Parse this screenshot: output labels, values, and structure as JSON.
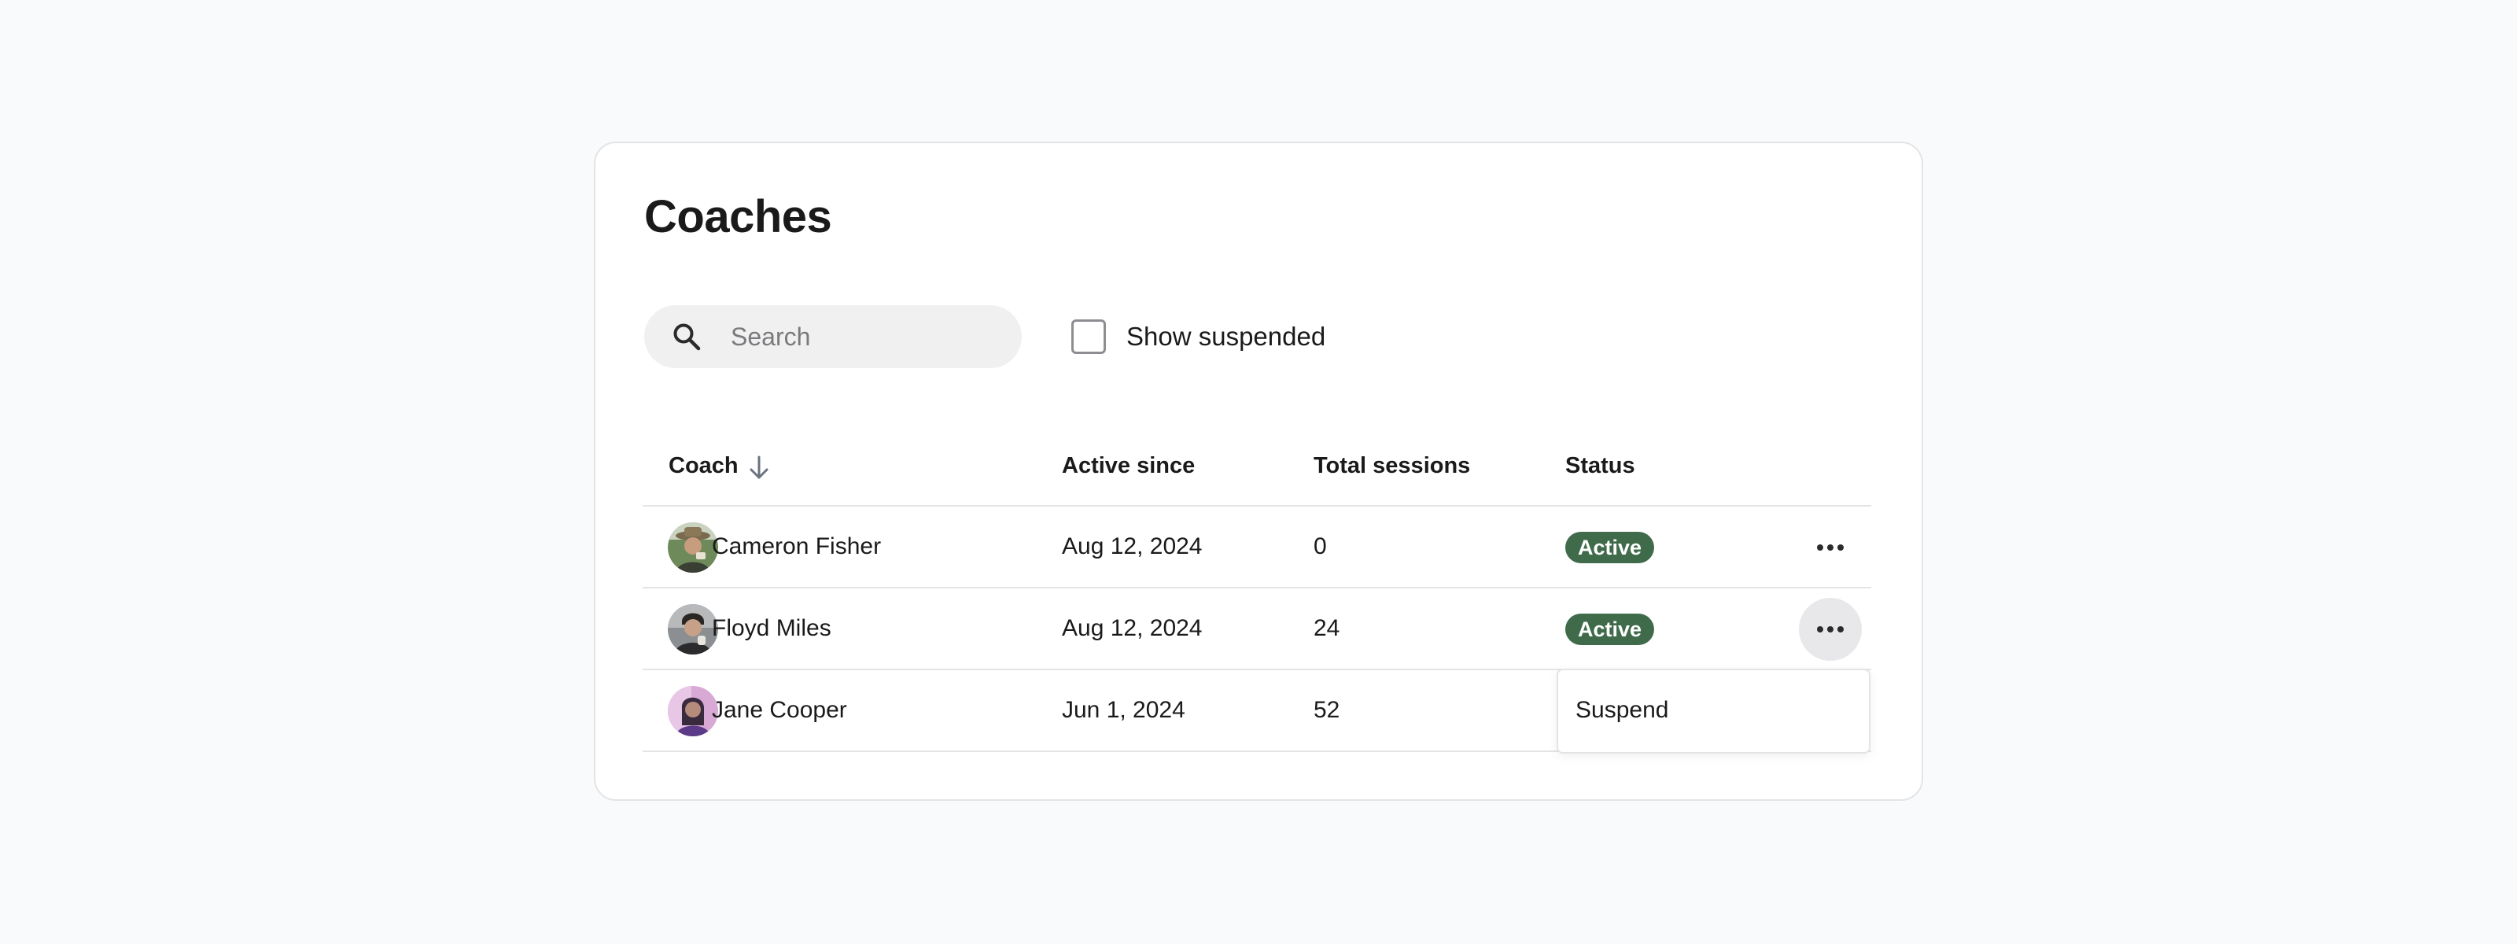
{
  "page": {
    "title": "Coaches"
  },
  "search": {
    "placeholder": "Search",
    "value": ""
  },
  "filters": {
    "show_suspended_label": "Show suspended",
    "show_suspended_checked": false
  },
  "table": {
    "columns": [
      "Coach",
      "Active since",
      "Total sessions",
      "Status"
    ],
    "sorted_column": "Coach",
    "sort_direction": "descending",
    "rows": [
      {
        "name": "Cameron Fisher",
        "active_since": "Aug 12, 2024",
        "total_sessions": "0",
        "status": "Active"
      },
      {
        "name": "Floyd Miles",
        "active_since": "Aug 12, 2024",
        "total_sessions": "24",
        "status": "Active"
      },
      {
        "name": "Jane Cooper",
        "active_since": "Jun 1, 2024",
        "total_sessions": "52",
        "status": ""
      }
    ]
  },
  "row_menu": {
    "items": [
      "Suspend"
    ]
  },
  "colors": {
    "background": "#f9fafb",
    "card": "#ffffff",
    "border": "#e3e4e6",
    "status_active": "#3f6b4b",
    "search_bg": "#f0f0f1"
  },
  "icons": {
    "search": "search-icon",
    "sort": "arrow-down-icon",
    "more": "more-horizontal-icon"
  }
}
